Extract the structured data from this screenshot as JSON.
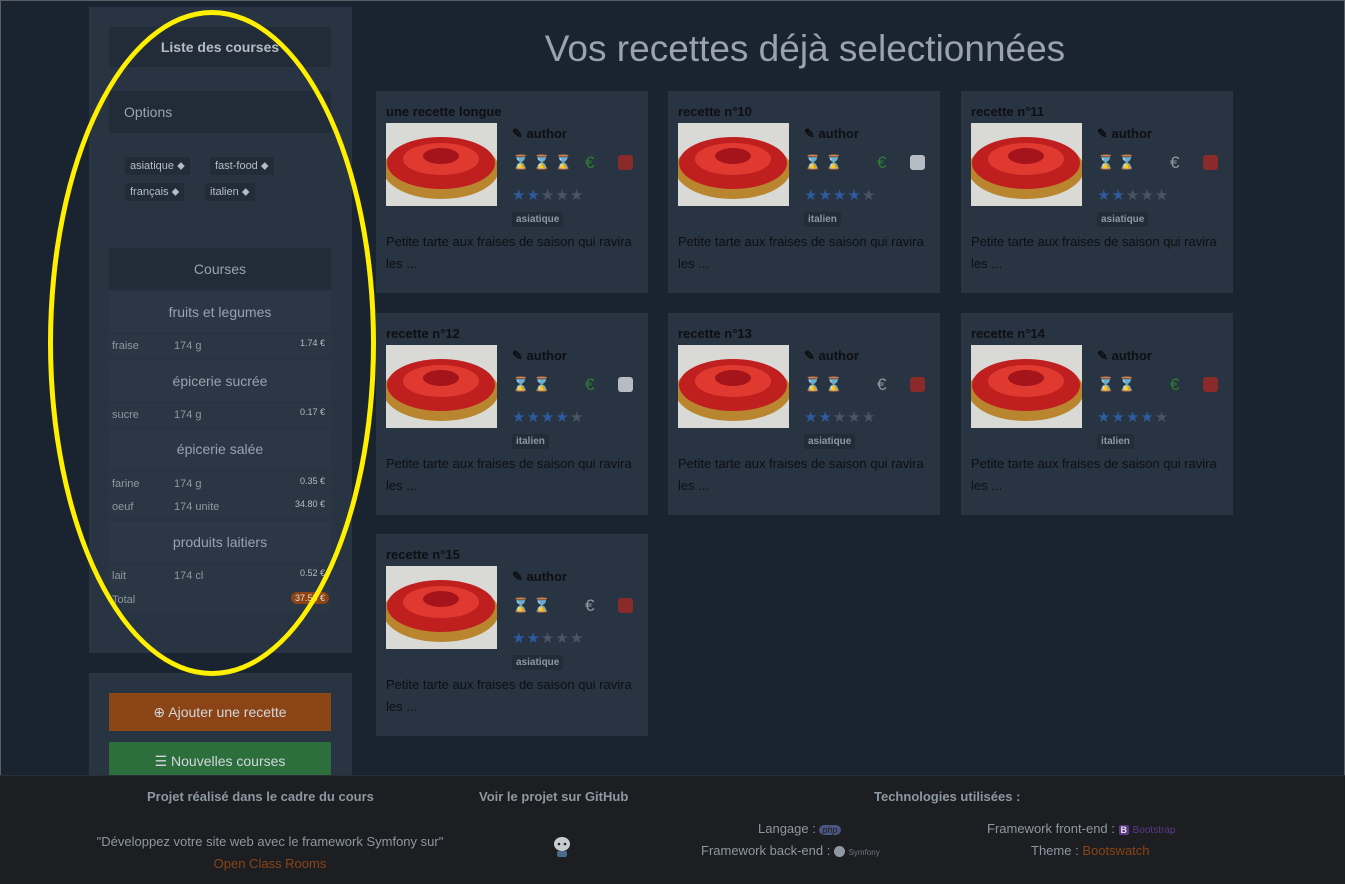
{
  "sidebar": {
    "title": "Liste des courses",
    "options_title": "Options",
    "tags": [
      "asiatique",
      "fast-food",
      "français",
      "italien"
    ],
    "courses_title": "Courses",
    "categories": [
      {
        "name": "fruits et legumes",
        "items": [
          {
            "name": "fraise",
            "qty": "174 g",
            "price": "1.74 €"
          }
        ]
      },
      {
        "name": "épicerie sucrée",
        "items": [
          {
            "name": "sucre",
            "qty": "174 g",
            "price": "0.17 €"
          }
        ]
      },
      {
        "name": "épicerie salée",
        "items": [
          {
            "name": "farine",
            "qty": "174 g",
            "price": "0.35 €"
          },
          {
            "name": "oeuf",
            "qty": "174 unite",
            "price": "34.80 €"
          }
        ]
      },
      {
        "name": "produits laitiers",
        "items": [
          {
            "name": "lait",
            "qty": "174 cl",
            "price": "0.52 €"
          }
        ]
      }
    ],
    "total_label": "Total",
    "total_value": "37.58 €"
  },
  "actions": {
    "add_recipe": "Ajouter une recette",
    "new_courses": "Nouvelles courses"
  },
  "main": {
    "title": "Vos recettes déjà selectionnées",
    "recipes": [
      {
        "title": "une recette longue",
        "author": "author",
        "hourglass": "⌛⌛⌛",
        "price_color": "green",
        "pot": "red",
        "stars": 2,
        "category": "asiatique",
        "description": "Petite tarte aux fraises de saison qui ravira les ..."
      },
      {
        "title": "recette n°10",
        "author": "author",
        "hourglass": "⌛⌛",
        "price_color": "green",
        "pot": "white",
        "stars": 4,
        "category": "italien",
        "description": "Petite tarte aux fraises de saison qui ravira les ..."
      },
      {
        "title": "recette n°11",
        "author": "author",
        "hourglass": "⌛⌛",
        "price_color": "grey",
        "pot": "red",
        "stars": 2,
        "category": "asiatique",
        "description": "Petite tarte aux fraises de saison qui ravira les ..."
      },
      {
        "title": "recette n°12",
        "author": "author",
        "hourglass": "⌛⌛",
        "price_color": "green",
        "pot": "white",
        "stars": 4,
        "category": "italien",
        "description": "Petite tarte aux fraises de saison qui ravira les ..."
      },
      {
        "title": "recette n°13",
        "author": "author",
        "hourglass": "⌛⌛",
        "price_color": "grey",
        "pot": "red",
        "stars": 2,
        "category": "asiatique",
        "description": "Petite tarte aux fraises de saison qui ravira les ..."
      },
      {
        "title": "recette n°14",
        "author": "author",
        "hourglass": "⌛⌛",
        "price_color": "green",
        "pot": "red",
        "stars": 4,
        "category": "italien",
        "description": "Petite tarte aux fraises de saison qui ravira les ..."
      },
      {
        "title": "recette n°15",
        "author": "author",
        "hourglass": "⌛⌛",
        "price_color": "grey",
        "pot": "red",
        "stars": 2,
        "category": "asiatique",
        "description": "Petite tarte aux fraises de saison qui ravira les ..."
      }
    ]
  },
  "footer": {
    "col1_title": "Projet réalisé dans le cadre du cours",
    "col1_text": "\"Développez votre site web avec le framework Symfony sur\"",
    "col1_link": "Open Class Rooms",
    "col2_title": "Voir le projet sur GitHub",
    "col3_title": "Technologies utilisées :",
    "lang_label": "Langage :",
    "lang_logo": "php",
    "backend_label": "Framework back-end :",
    "backend_logo": "Symfony",
    "frontend_label": "Framework front-end :",
    "frontend_logo_letter": "B",
    "frontend_logo": "Bootstrap",
    "theme_label": "Theme :",
    "theme_link": "Bootswatch"
  },
  "colors": {
    "accent_orange": "#8a4416",
    "accent_green": "#2d6e3d",
    "highlight": "#fff000"
  }
}
